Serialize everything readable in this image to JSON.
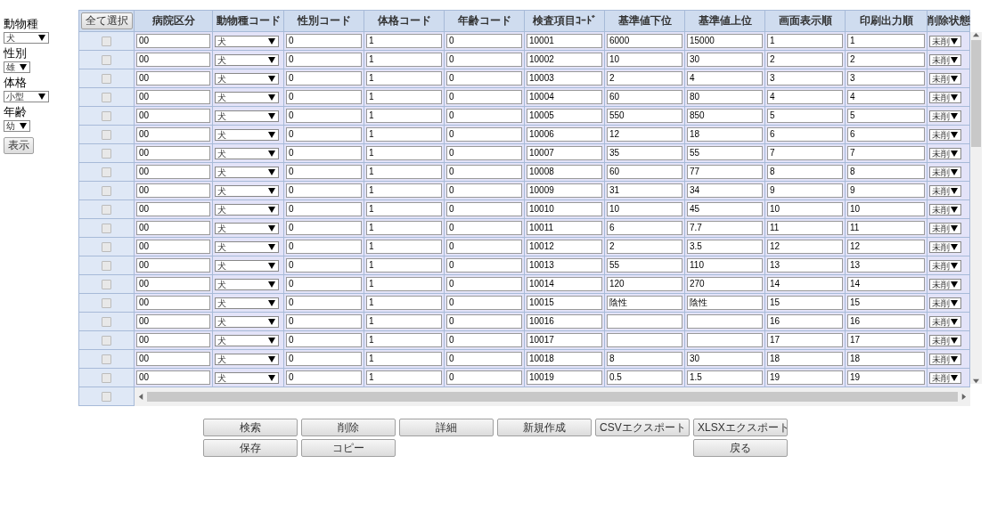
{
  "filters": [
    {
      "label": "動物種",
      "value": "犬",
      "kind": "wide"
    },
    {
      "label": "性別",
      "value": "雄",
      "kind": "narrow"
    },
    {
      "label": "体格",
      "value": "小型",
      "kind": "wide"
    },
    {
      "label": "年齢",
      "value": "幼",
      "kind": "narrow"
    }
  ],
  "show_button": "表示",
  "table": {
    "select_all": "全て選択",
    "columns": [
      "病院区分",
      "動物種コード",
      "性別コード",
      "体格コード",
      "年齢コード",
      "検査項目ｺｰﾄﾞ",
      "基準値下位",
      "基準値上位",
      "画面表示順",
      "印刷出力順",
      "削除状態"
    ],
    "rows": [
      {
        "checked": false,
        "hospital": "00",
        "species": "犬",
        "sex": "0",
        "size": "1",
        "age": "0",
        "code": "10001",
        "lower": "6000",
        "upper": "15000",
        "display": "1",
        "print": "1",
        "deleted": "未削"
      },
      {
        "checked": false,
        "hospital": "00",
        "species": "犬",
        "sex": "0",
        "size": "1",
        "age": "0",
        "code": "10002",
        "lower": "10",
        "upper": "30",
        "display": "2",
        "print": "2",
        "deleted": "未削"
      },
      {
        "checked": false,
        "hospital": "00",
        "species": "犬",
        "sex": "0",
        "size": "1",
        "age": "0",
        "code": "10003",
        "lower": "2",
        "upper": "4",
        "display": "3",
        "print": "3",
        "deleted": "未削"
      },
      {
        "checked": false,
        "hospital": "00",
        "species": "犬",
        "sex": "0",
        "size": "1",
        "age": "0",
        "code": "10004",
        "lower": "60",
        "upper": "80",
        "display": "4",
        "print": "4",
        "deleted": "未削"
      },
      {
        "checked": false,
        "hospital": "00",
        "species": "犬",
        "sex": "0",
        "size": "1",
        "age": "0",
        "code": "10005",
        "lower": "550",
        "upper": "850",
        "display": "5",
        "print": "5",
        "deleted": "未削"
      },
      {
        "checked": false,
        "hospital": "00",
        "species": "犬",
        "sex": "0",
        "size": "1",
        "age": "0",
        "code": "10006",
        "lower": "12",
        "upper": "18",
        "display": "6",
        "print": "6",
        "deleted": "未削"
      },
      {
        "checked": false,
        "hospital": "00",
        "species": "犬",
        "sex": "0",
        "size": "1",
        "age": "0",
        "code": "10007",
        "lower": "35",
        "upper": "55",
        "display": "7",
        "print": "7",
        "deleted": "未削"
      },
      {
        "checked": false,
        "hospital": "00",
        "species": "犬",
        "sex": "0",
        "size": "1",
        "age": "0",
        "code": "10008",
        "lower": "60",
        "upper": "77",
        "display": "8",
        "print": "8",
        "deleted": "未削"
      },
      {
        "checked": false,
        "hospital": "00",
        "species": "犬",
        "sex": "0",
        "size": "1",
        "age": "0",
        "code": "10009",
        "lower": "31",
        "upper": "34",
        "display": "9",
        "print": "9",
        "deleted": "未削"
      },
      {
        "checked": false,
        "hospital": "00",
        "species": "犬",
        "sex": "0",
        "size": "1",
        "age": "0",
        "code": "10010",
        "lower": "10",
        "upper": "45",
        "display": "10",
        "print": "10",
        "deleted": "未削"
      },
      {
        "checked": false,
        "hospital": "00",
        "species": "犬",
        "sex": "0",
        "size": "1",
        "age": "0",
        "code": "10011",
        "lower": "6",
        "upper": "7.7",
        "display": "11",
        "print": "11",
        "deleted": "未削"
      },
      {
        "checked": false,
        "hospital": "00",
        "species": "犬",
        "sex": "0",
        "size": "1",
        "age": "0",
        "code": "10012",
        "lower": "2",
        "upper": "3.5",
        "display": "12",
        "print": "12",
        "deleted": "未削"
      },
      {
        "checked": false,
        "hospital": "00",
        "species": "犬",
        "sex": "0",
        "size": "1",
        "age": "0",
        "code": "10013",
        "lower": "55",
        "upper": "110",
        "display": "13",
        "print": "13",
        "deleted": "未削"
      },
      {
        "checked": false,
        "hospital": "00",
        "species": "犬",
        "sex": "0",
        "size": "1",
        "age": "0",
        "code": "10014",
        "lower": "120",
        "upper": "270",
        "display": "14",
        "print": "14",
        "deleted": "未削"
      },
      {
        "checked": false,
        "hospital": "00",
        "species": "犬",
        "sex": "0",
        "size": "1",
        "age": "0",
        "code": "10015",
        "lower": "陰性",
        "upper": "陰性",
        "display": "15",
        "print": "15",
        "deleted": "未削"
      },
      {
        "checked": false,
        "hospital": "00",
        "species": "犬",
        "sex": "0",
        "size": "1",
        "age": "0",
        "code": "10016",
        "display": "16",
        "print": "16",
        "deleted": "未削"
      },
      {
        "checked": false,
        "hospital": "00",
        "species": "犬",
        "sex": "0",
        "size": "1",
        "age": "0",
        "code": "10017",
        "display": "17",
        "print": "17",
        "deleted": "未削"
      },
      {
        "checked": false,
        "hospital": "00",
        "species": "犬",
        "sex": "0",
        "size": "1",
        "age": "0",
        "code": "10018",
        "lower": "8",
        "upper": "30",
        "display": "18",
        "print": "18",
        "deleted": "未削"
      },
      {
        "checked": false,
        "hospital": "00",
        "species": "犬",
        "sex": "0",
        "size": "1",
        "age": "0",
        "code": "10019",
        "lower": "0.5",
        "upper": "1.5",
        "display": "19",
        "print": "19",
        "deleted": "未削"
      }
    ],
    "partial_row": {
      "checked": false
    }
  },
  "button_rows": [
    [
      {
        "kind": "button",
        "label": "検索"
      },
      {
        "kind": "button",
        "label": "削除"
      },
      {
        "kind": "button",
        "label": "詳細"
      },
      {
        "kind": "button",
        "label": "新規作成"
      },
      {
        "kind": "button",
        "label": "CSVエクスポート"
      },
      {
        "kind": "button",
        "label": "XLSXエクスポート"
      }
    ],
    [
      {
        "kind": "button",
        "label": "保存"
      },
      {
        "kind": "button",
        "label": "コピー"
      },
      {
        "kind": "gap"
      },
      {
        "kind": "gap"
      },
      {
        "kind": "gap"
      },
      {
        "kind": "button",
        "label": "戻る"
      }
    ]
  ]
}
